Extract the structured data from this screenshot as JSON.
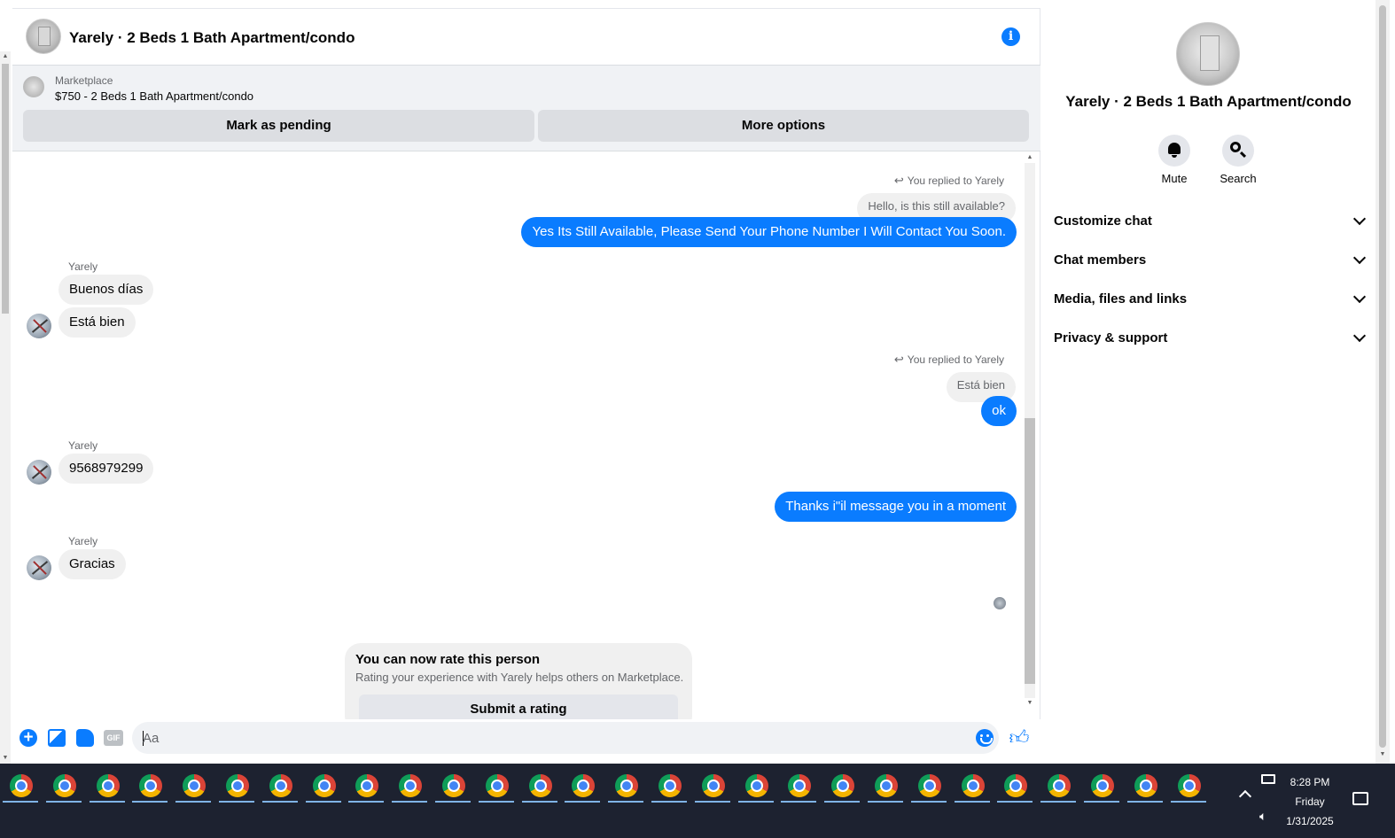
{
  "chat": {
    "header_title": "Yarely · 2 Beds 1 Bath Apartment/condo",
    "marketplace_label": "Marketplace",
    "listing": "$750 - 2 Beds 1 Bath Apartment/condo",
    "mark_pending": "Mark as pending",
    "more_options": "More options"
  },
  "thread": {
    "reply_note_1": "You replied to Yarely",
    "quoted_1": "Hello, is this still available?",
    "out_1": "Yes Its Still Available, Please Send Your Phone Number I Will Contact You Soon.",
    "sender_1": "Yarely",
    "in_1a": "Buenos días",
    "in_1b": "Está bien",
    "reply_note_2": "You replied to Yarely",
    "quoted_2": "Está bien",
    "out_2": "ok",
    "sender_2": "Yarely",
    "in_2": "9568979299",
    "out_3": "Thanks i\"il message you in a moment",
    "sender_3": "Yarely",
    "in_3": "Gracias",
    "rate_title": "You can now rate this person",
    "rate_sub": "Rating your experience with Yarely helps others on Marketplace.",
    "rate_button": "Submit a rating"
  },
  "composer": {
    "placeholder": "Aa",
    "gif_label": "GIF"
  },
  "right_panel": {
    "title": "Yarely · 2 Beds 1 Bath Apartment/condo",
    "mute": "Mute",
    "search": "Search",
    "sections": [
      "Customize chat",
      "Chat members",
      "Media, files and links",
      "Privacy & support"
    ]
  },
  "taskbar": {
    "time": "8:28 PM",
    "day": "Friday",
    "date": "1/31/2025"
  },
  "colors": {
    "accent": "#0a7cff",
    "taskbar": "#1d2230"
  }
}
